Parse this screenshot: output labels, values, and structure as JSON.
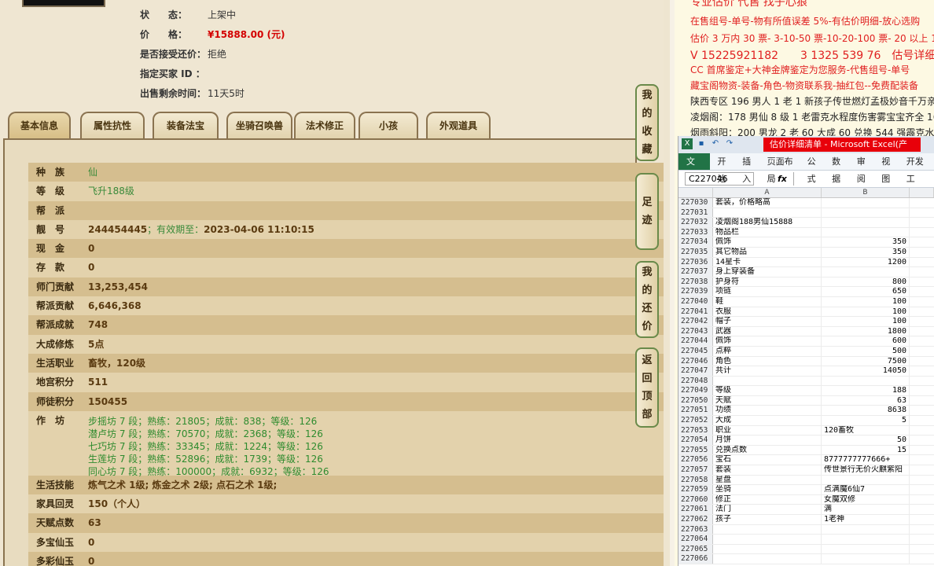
{
  "listing": {
    "status_label": "状　　态：",
    "status": "上架中",
    "price_label": "价　　格：",
    "price": "¥15888.00 (元)",
    "bargain_label": "是否接受还价：",
    "bargain": "拒绝",
    "buyer_label": "指定买家 ID ：",
    "buyer": "",
    "time_label": "出售剩余时间：",
    "time_left": "11天5时"
  },
  "tabs": [
    "基本信息",
    "属性抗性",
    "装备法宝",
    "坐骑召唤兽",
    "法术修正",
    "小孩",
    "外观道具"
  ],
  "side_buttons": [
    [
      "我",
      "的",
      "收",
      "藏"
    ],
    [
      "足",
      "迹"
    ],
    [
      "我",
      "的",
      "还",
      "价"
    ],
    [
      "返",
      "回",
      "顶",
      "部"
    ]
  ],
  "basic_info": [
    {
      "k": "种　族",
      "v": "仙",
      "style": "green"
    },
    {
      "k": "等　级",
      "v": "飞升188级",
      "style": "green"
    },
    {
      "k": "帮　派",
      "v": ""
    },
    {
      "k": "靓　号",
      "v": "244454445",
      "extra": "；有效期至：",
      "extra2": "2023-04-06 11:10:15"
    },
    {
      "k": "现　金",
      "v": "0"
    },
    {
      "k": "存　款",
      "v": "0"
    },
    {
      "k": "师门贡献",
      "v": "13,253,454"
    },
    {
      "k": "帮派贡献",
      "v": "6,646,368"
    },
    {
      "k": "帮派成就",
      "v": "748"
    },
    {
      "k": "大成修炼",
      "v": "5点"
    },
    {
      "k": "生活职业",
      "v": "畜牧，120级"
    },
    {
      "k": "地宫积分",
      "v": "511"
    },
    {
      "k": "师徒积分",
      "v": "150455"
    }
  ],
  "workshop": {
    "k": "作　坊",
    "lines": [
      "步摇坊 7 段；熟练：21805；成就：838；等级：126",
      "潜卢坊 7 段；熟练：70570；成就：2368；等级：126",
      "七巧坊 7 段；熟练：33345；成就：1224；等级：126",
      "生莲坊 7 段；熟练：52896；成就：1739；等级：126",
      "同心坊 7 段；熟练：100000；成就：6932；等级：126"
    ]
  },
  "basic_info2": [
    {
      "k": "生活技能",
      "v": "炼气之术 1级; 炼金之术 2级; 点石之术 1级;"
    },
    {
      "k": "家具回灵",
      "v": "150（个人）"
    },
    {
      "k": "天赋点数",
      "v": "63"
    },
    {
      "k": "多宝仙玉",
      "v": "0"
    },
    {
      "k": "多彩仙玉",
      "v": "0"
    }
  ],
  "right_lines": [
    {
      "t": "专业估价 代售 找子心狼",
      "big": true
    },
    {
      "t": "在售组号-单号-物有所值误差 5%-有估价明细-放心选购"
    },
    {
      "t": "估价 3 万内 30 票- 3-10-50 票-10-20-100 票- 20 以上 150 票-1 票"
    },
    {
      "t": "V 15225921182　　3 1325 539 76　估号详细明细",
      "big": true
    },
    {
      "t": "CC 首席鉴定+大神金牌鉴定为您服务-代售组号-单号"
    },
    {
      "t": "藏宝阁物资-装备-角色-物资联系我-抽红包--免费配装备"
    },
    {
      "t": "陕西专区 196 男人 1 老 1 新孩子传世燃灯孟极妙音千万亲密 4",
      "dark": true
    },
    {
      "t": "凌烟阁：178 男仙 8 级 1 老雷克水程度伤害雾宝宝齐全 16888+",
      "dark": true
    },
    {
      "t": "烟雨斜阳：200 男龙 2 老 60 大成 60 兑换 544 强霹克水 178618",
      "dark": true
    }
  ],
  "excel": {
    "title": "估价详细清单 - Microsoft Excel(产品...",
    "ribbon": [
      "文件",
      "开始",
      "插入",
      "页面布局",
      "公式",
      "数据",
      "审阅",
      "视图",
      "开发工"
    ],
    "namebox": "C227046",
    "fx": "fx",
    "col_a": "A",
    "col_b": "B",
    "rows": [
      [
        "227030",
        "套装，价格略高",
        ""
      ],
      [
        "227031",
        "",
        ""
      ],
      [
        "227032",
        "凌烟阁188男仙15888",
        ""
      ],
      [
        "227033",
        "物品栏",
        ""
      ],
      [
        "227034",
        "佩饰",
        "350"
      ],
      [
        "227035",
        "其它物品",
        "350"
      ],
      [
        "227036",
        "14星卡",
        "1200"
      ],
      [
        "227037",
        "身上穿装备",
        ""
      ],
      [
        "227038",
        "护身符",
        "800"
      ],
      [
        "227039",
        "项链",
        "650"
      ],
      [
        "227040",
        "鞋",
        "100"
      ],
      [
        "227041",
        "衣服",
        "100"
      ],
      [
        "227042",
        "帽子",
        "100"
      ],
      [
        "227043",
        "武器",
        "1800"
      ],
      [
        "227044",
        "佩饰",
        "600"
      ],
      [
        "227045",
        "点粹",
        "500"
      ],
      [
        "227046",
        "角色",
        "7500"
      ],
      [
        "227047",
        "共计",
        "14050"
      ],
      [
        "227048",
        "",
        ""
      ],
      [
        "227049",
        "等级",
        "188"
      ],
      [
        "227050",
        "天赋",
        "63"
      ],
      [
        "227051",
        "功绩",
        "8638"
      ],
      [
        "227052",
        "大成",
        "5"
      ],
      [
        "227053",
        "职业",
        "120畜牧"
      ],
      [
        "227054",
        "月饼",
        "50"
      ],
      [
        "227055",
        "兑换点数",
        "15"
      ],
      [
        "227056",
        "宝石",
        "8777777777666+"
      ],
      [
        "227057",
        "套装",
        "传世景行无价火麒紫阳"
      ],
      [
        "227058",
        "星盘",
        ""
      ],
      [
        "227059",
        "坐骑",
        "点满魔6仙7"
      ],
      [
        "227060",
        "修正",
        "女魔双修"
      ],
      [
        "227061",
        "法门",
        "满"
      ],
      [
        "227062",
        "孩子",
        "1老神"
      ],
      [
        "227063",
        "",
        ""
      ],
      [
        "227064",
        "",
        ""
      ],
      [
        "227065",
        "",
        ""
      ],
      [
        "227066",
        "",
        ""
      ]
    ]
  }
}
